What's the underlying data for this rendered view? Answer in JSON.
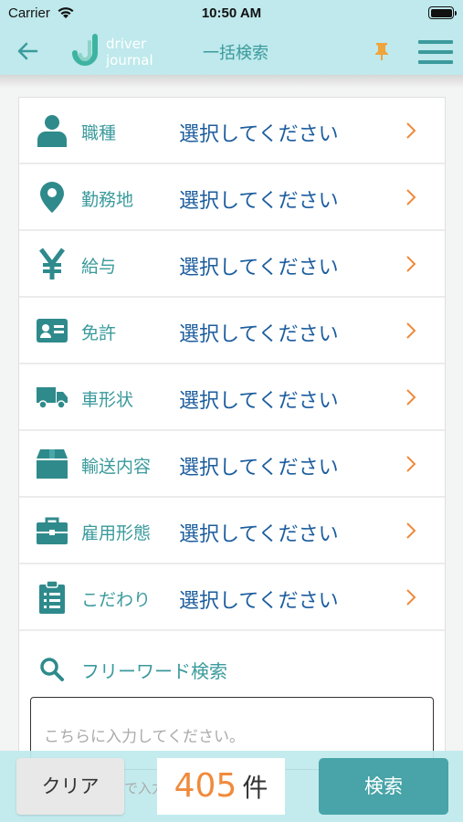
{
  "status_bar": {
    "carrier": "Carrier",
    "time": "10:50 AM"
  },
  "header": {
    "logo_line1": "driver",
    "logo_line2": "journal",
    "title": "一括検索"
  },
  "filters": [
    {
      "label": "職種",
      "value": "選択してください",
      "icon": "person-icon"
    },
    {
      "label": "勤務地",
      "value": "選択してください",
      "icon": "map-pin-icon"
    },
    {
      "label": "給与",
      "value": "選択してください",
      "icon": "yen-icon"
    },
    {
      "label": "免許",
      "value": "選択してください",
      "icon": "license-card-icon"
    },
    {
      "label": "車形状",
      "value": "選択してください",
      "icon": "truck-icon"
    },
    {
      "label": "輸送内容",
      "value": "選択してください",
      "icon": "box-icon"
    },
    {
      "label": "雇用形態",
      "value": "選択してください",
      "icon": "briefcase-icon"
    },
    {
      "label": "こだわり",
      "value": "選択してください",
      "icon": "clipboard-icon"
    }
  ],
  "freeword": {
    "label": "フリーワード検索",
    "placeholder": "こちらに入力してください。",
    "hint": "で入力"
  },
  "bottom": {
    "clear_label": "クリア",
    "count": "405",
    "count_unit": "件",
    "search_label": "検索"
  },
  "colors": {
    "header_bg": "#bfe9ec",
    "accent_teal": "#3b9a9c",
    "value_blue": "#1b5c9d",
    "chevron_orange": "#f08a3c",
    "search_button": "#48a4a8"
  }
}
